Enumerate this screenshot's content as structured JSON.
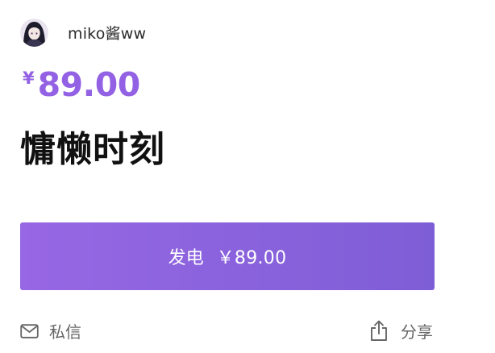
{
  "author": {
    "name": "miko酱ww",
    "avatar_icon": "user-avatar"
  },
  "price": {
    "currency": "¥",
    "amount": "89.00"
  },
  "product": {
    "title": "慵懒时刻"
  },
  "donate_button": {
    "label": "发电",
    "price": "￥89.00"
  },
  "actions": {
    "message": {
      "label": "私信",
      "icon": "mail-icon"
    },
    "share": {
      "label": "分享",
      "icon": "share-icon"
    }
  },
  "colors": {
    "accent": "#9361e3",
    "button_start": "#9767e4",
    "button_end": "#7e5ed6",
    "muted_text": "#666666"
  }
}
